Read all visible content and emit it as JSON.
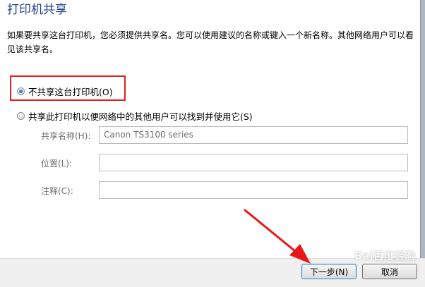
{
  "title": "打印机共享",
  "description": "如果要共享这台打印机，您必须提供共享名。您可以使用建议的名称或键入一个新名称。其他网络用户可以看见该共享名。",
  "options": {
    "no_share": {
      "label": "不共享这台打印机(O)",
      "selected": true
    },
    "share": {
      "label": "共享此打印机以便网络中的其他用户可以找到并使用它(S)",
      "selected": false
    }
  },
  "fields": {
    "share_name": {
      "label": "共享名称(H):",
      "value": "Canon TS3100 series"
    },
    "location": {
      "label": "位置(L):",
      "value": ""
    },
    "comment": {
      "label": "注释(C):",
      "value": ""
    }
  },
  "buttons": {
    "next": "下一步(N)",
    "cancel": "取消"
  },
  "watermark": "Bai百度经验",
  "colors": {
    "title": "#1e3f8f",
    "highlight": "#e32020",
    "arrow": "#e81818"
  }
}
